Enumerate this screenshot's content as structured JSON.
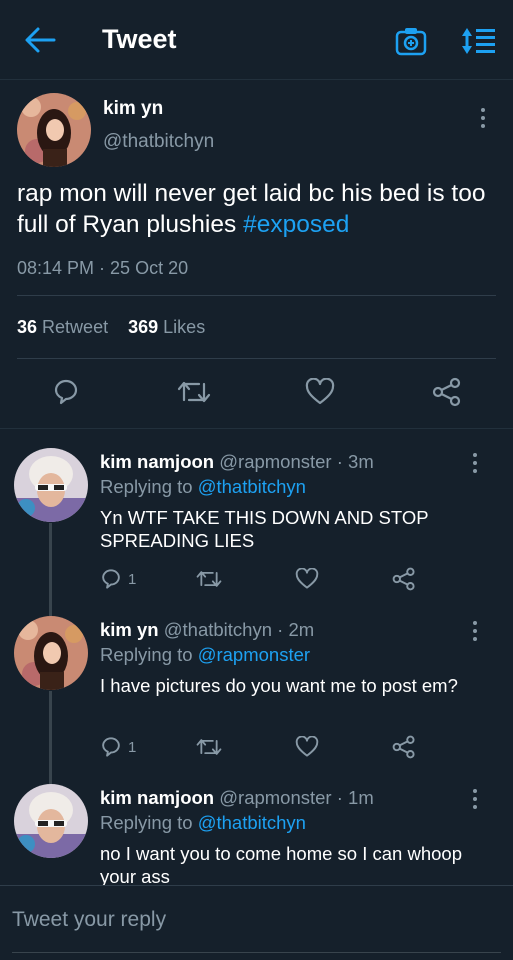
{
  "header": {
    "title": "Tweet"
  },
  "tweet": {
    "name": "kim yn",
    "handle": "@thatbitchyn",
    "text_before": "rap mon will never get laid bc his bed is too full of Ryan plushies ",
    "hashtag": "#exposed",
    "time": "08:14 PM · 25 Oct 20",
    "retweets": "36",
    "retweet_label": "Retweet",
    "likes": "369",
    "likes_label": "Likes"
  },
  "replies": [
    {
      "name": "kim namjoon",
      "meta": "@rapmonster · 3m",
      "replying_prefix": "Replying to ",
      "replying_handle": "@thatbitchyn",
      "text": "Yn WTF TAKE THIS DOWN AND STOP SPREADING LIES",
      "reply_count": "1"
    },
    {
      "name": "kim yn",
      "meta": "@thatbitchyn · 2m",
      "replying_prefix": "Replying to ",
      "replying_handle": "@rapmonster",
      "text": "I have pictures do you want me to post em?",
      "reply_count": "1"
    },
    {
      "name": "kim namjoon",
      "meta": "@rapmonster · 1m",
      "replying_prefix": "Replying to ",
      "replying_handle": "@thatbitchyn",
      "text": "no I want you to come home so I can whoop your ass"
    }
  ],
  "composer": {
    "placeholder": "Tweet your reply"
  },
  "colors": {
    "background": "#15202b",
    "accent": "#1da1f2",
    "muted": "#8899a6"
  },
  "icons": [
    "back-arrow-icon",
    "camera-icon",
    "sort-icon",
    "reply-icon",
    "retweet-icon",
    "like-icon",
    "share-icon",
    "more-icon"
  ]
}
